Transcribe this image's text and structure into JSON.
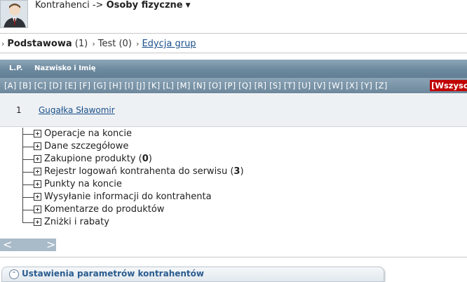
{
  "header": {
    "path_prefix": "Kontrahenci ->",
    "current": "Osoby fizyczne"
  },
  "tabs": [
    {
      "label": "Podstawowa",
      "count": "(1)"
    },
    {
      "label": "Test",
      "count": "(0)"
    }
  ],
  "tabs_link": "Edycja grup",
  "table": {
    "col_lp": "L.P.",
    "col_name": "Nazwisko i Imię",
    "alphabet": "[A] [B] [C] [D] [E] [F] [G] [H] [I] [J] [K] [L] [M] [N] [O] [P] [Q] [R] [S] [T] [U] [V] [W] [X] [Y] [Z]",
    "all_label": "[Wszyscy]",
    "rows": [
      {
        "lp": "1",
        "name": "Gugałka Sławomir"
      }
    ]
  },
  "tree": [
    {
      "label": "Operacje na koncie",
      "count": ""
    },
    {
      "label": "Dane szczegółowe",
      "count": ""
    },
    {
      "label": "Zakupione produkty",
      "count": "0"
    },
    {
      "label": "Rejestr logowań kontrahenta do serwisu",
      "count": "3"
    },
    {
      "label": "Punkty na koncie",
      "count": ""
    },
    {
      "label": "Wysyłanie informacji do kontrahenta",
      "count": ""
    },
    {
      "label": "Komentarze do produktów",
      "count": ""
    },
    {
      "label": "Zniżki i rabaty",
      "count": ""
    }
  ],
  "pager": {
    "prev": "<",
    "next": ">"
  },
  "settings": {
    "title": "Ustawienia parametrów kontrahentów"
  },
  "colors": {
    "header_bar": "#6f8ba0",
    "all_badge": "#c00000",
    "link": "#1a4f8a"
  }
}
